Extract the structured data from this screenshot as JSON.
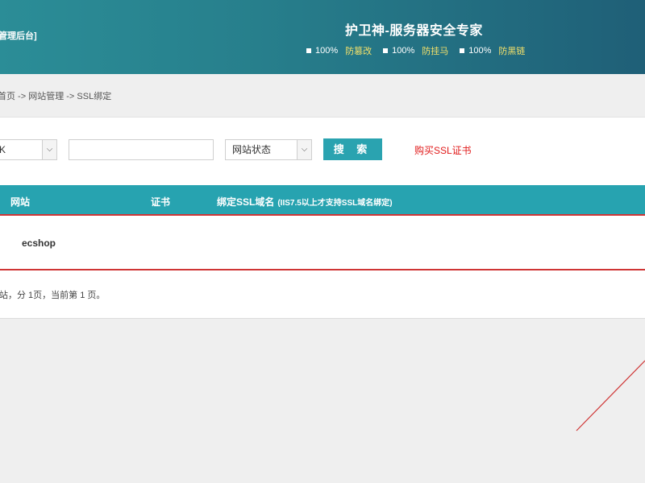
{
  "header": {
    "left_text": "管理后台]",
    "title": "护卫神-服务器安全专家",
    "features": [
      {
        "percent": "100%",
        "label": "防篡改"
      },
      {
        "percent": "100%",
        "label": "防挂马"
      },
      {
        "percent": "100%",
        "label": "防黑链"
      }
    ]
  },
  "breadcrumb": "首页 -> 网站管理 -> SSL绑定",
  "search": {
    "select_1_value": "K",
    "text_value": "",
    "select_2_value": "网站状态",
    "button_label": "搜 索",
    "buy_link": "购买SSL证书"
  },
  "table": {
    "headers": [
      "网站",
      "证书",
      "绑定SSL域名"
    ],
    "header_note": "(IIS7.5以上才支持SSL域名绑定)",
    "rows": [
      {
        "site": "ecshop"
      }
    ]
  },
  "summary": "站，分 1页，当前第 1 页。",
  "colors": {
    "accent": "#27a3b0",
    "header_dark": "#1f5f77",
    "alert_red": "#cf3535",
    "feature_yellow": "#f3e06a"
  }
}
